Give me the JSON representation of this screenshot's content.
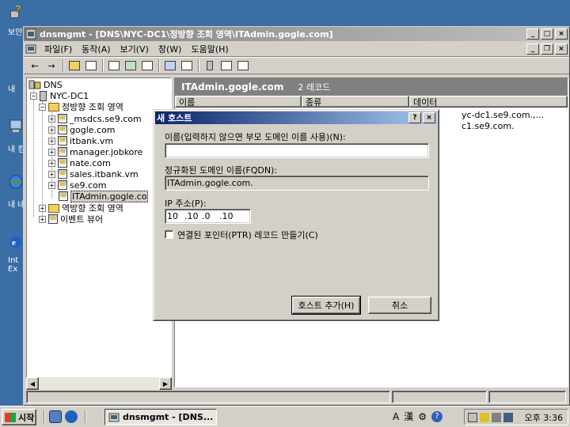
{
  "desktop": {
    "icons": [
      {
        "name": "help-icon",
        "label": "보안"
      },
      {
        "name": "folder-icon",
        "label": "내"
      },
      {
        "name": "computer-icon",
        "label": "내 컴"
      },
      {
        "name": "network-icon",
        "label": "내 네"
      },
      {
        "name": "ie-icon",
        "label": "Int Ex"
      }
    ]
  },
  "main_window": {
    "title": "dnsmgmt - [DNS\\NYC-DC1\\정방향 조회 영역\\ITAdmin.gogle.com]",
    "menu": [
      "파일(F)",
      "동작(A)",
      "보기(V)",
      "창(W)",
      "도움말(H)"
    ]
  },
  "tree": {
    "root": "DNS",
    "server": "NYC-DC1",
    "forward_zone": "정방향 조회 영역",
    "zones": [
      "_msdcs.se9.com",
      "gogle.com",
      "itbank.vm",
      "manager.jobkore",
      "nate.com",
      "sales.itbank.vm",
      "se9.com",
      "ITAdmin.gogle.co"
    ],
    "reverse_zone": "역방향 조회 영역",
    "event_viewer": "이벤트 뷰어"
  },
  "right_pane": {
    "zone_title": "ITAdmin.gogle.com",
    "record_count": "2 레코드",
    "columns": [
      "이름",
      "종류",
      "데이터"
    ],
    "rows": [
      {
        "data": "yc-dc1.se9.com.,..."
      },
      {
        "data": "c1.se9.com."
      }
    ]
  },
  "dialog": {
    "title": "새 호스트",
    "name_label": "이름(입력하지 않으면 부모 도메인 이름 사용)(N):",
    "name_value": "",
    "fqdn_label": "정규화된 도메인 이름(FQDN):",
    "fqdn_value": "ITAdmin.gogle.com.",
    "ip_label": "IP 주소(P):",
    "ip_octets": [
      "10",
      ".10",
      ".0",
      ".10"
    ],
    "ptr_label": "연결된 포인터(PTR) 레코드 만들기(C)",
    "ptr_checked": false,
    "add_button": "호스트 추가(H)",
    "cancel_button": "취소"
  },
  "taskbar": {
    "start_label": "시작",
    "task_label": "dnsmgmt - [DNS...",
    "ime": [
      "A",
      "漢"
    ],
    "clock": "오후 3:36"
  }
}
